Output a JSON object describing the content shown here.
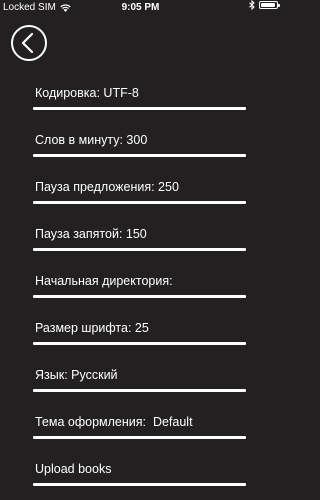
{
  "status_bar": {
    "carrier": "Locked SIM",
    "time": "9:05 PM"
  },
  "settings": {
    "items": [
      {
        "label": "Кодировка: UTF-8"
      },
      {
        "label": "Слов в минуту: 300"
      },
      {
        "label": "Пауза предложения: 250"
      },
      {
        "label": "Пауза запятой: 150"
      },
      {
        "label": "Начальная директория:"
      },
      {
        "label": "Размер шрифта: 25"
      },
      {
        "label": "Язык: Русский"
      },
      {
        "label": "Тема оформления:  Default"
      },
      {
        "label": "Upload books"
      }
    ]
  },
  "icons": {
    "back": "chevron-left-icon",
    "wifi": "wifi-icon",
    "bluetooth": "bluetooth-icon",
    "battery": "battery-icon"
  },
  "colors": {
    "background": "#222020",
    "foreground": "#ffffff"
  }
}
